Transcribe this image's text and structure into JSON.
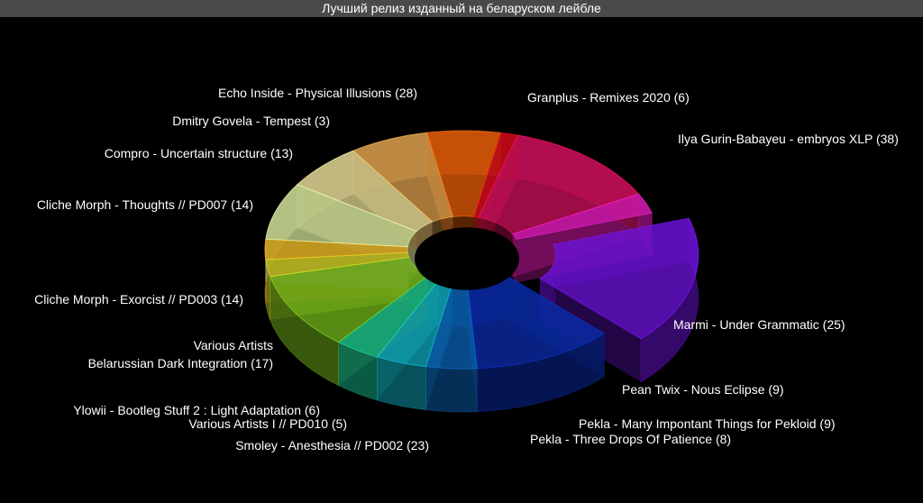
{
  "chart_data": {
    "type": "pie",
    "variant": "3d-donut",
    "title": "Лучший релиз изданный на беларуском лейбле",
    "slices": [
      {
        "label": "Ilya Gurin-Babayeu - embryos XLP (38)",
        "value": 38,
        "color": "#6a12d6",
        "exploded": true
      },
      {
        "label": "Marmi - Under Grammatic (25)",
        "value": 25,
        "color": "#0a2aa8"
      },
      {
        "label": "Pean Twix - Nous Eclipse (9)",
        "value": 9,
        "color": "#0a5fb0"
      },
      {
        "label": "Pekla - Many Impontant Things for Pekloid (9)",
        "value": 9,
        "color": "#0fa3b6"
      },
      {
        "label": "Pekla - Three Drops Of Patience (8)",
        "value": 8,
        "color": "#14b58a"
      },
      {
        "label": "Smoley - Anesthesia // PD002 (23)",
        "value": 23,
        "color": "#6fb21a"
      },
      {
        "label": "Various Artists I // PD010 (5)",
        "value": 5,
        "color": "#b8b91a"
      },
      {
        "label": "Ylowii - Bootleg Stuff 2 : Light Adaptation (6)",
        "value": 6,
        "color": "#d8a41a"
      },
      {
        "label": "Various Artists\nBelarussian Dark Integration (17)",
        "value": 17,
        "color": "#c8d892"
      },
      {
        "label": "Cliche Morph - Exorcist // PD003 (14)",
        "value": 14,
        "color": "#d8cf8e"
      },
      {
        "label": "Cliche Morph - Thoughts // PD007 (14)",
        "value": 14,
        "color": "#d49a4a"
      },
      {
        "label": "Compro - Uncertain structure (13)",
        "value": 13,
        "color": "#e05a0a"
      },
      {
        "label": "Dmitry Govela - Tempest (3)",
        "value": 3,
        "color": "#c80a1a"
      },
      {
        "label": "Echo Inside - Physical Illusions (28)",
        "value": 28,
        "color": "#c81058"
      },
      {
        "label": "Granplus - Remixes 2020 (6)",
        "value": 6,
        "color": "#d01ab0"
      }
    ]
  }
}
